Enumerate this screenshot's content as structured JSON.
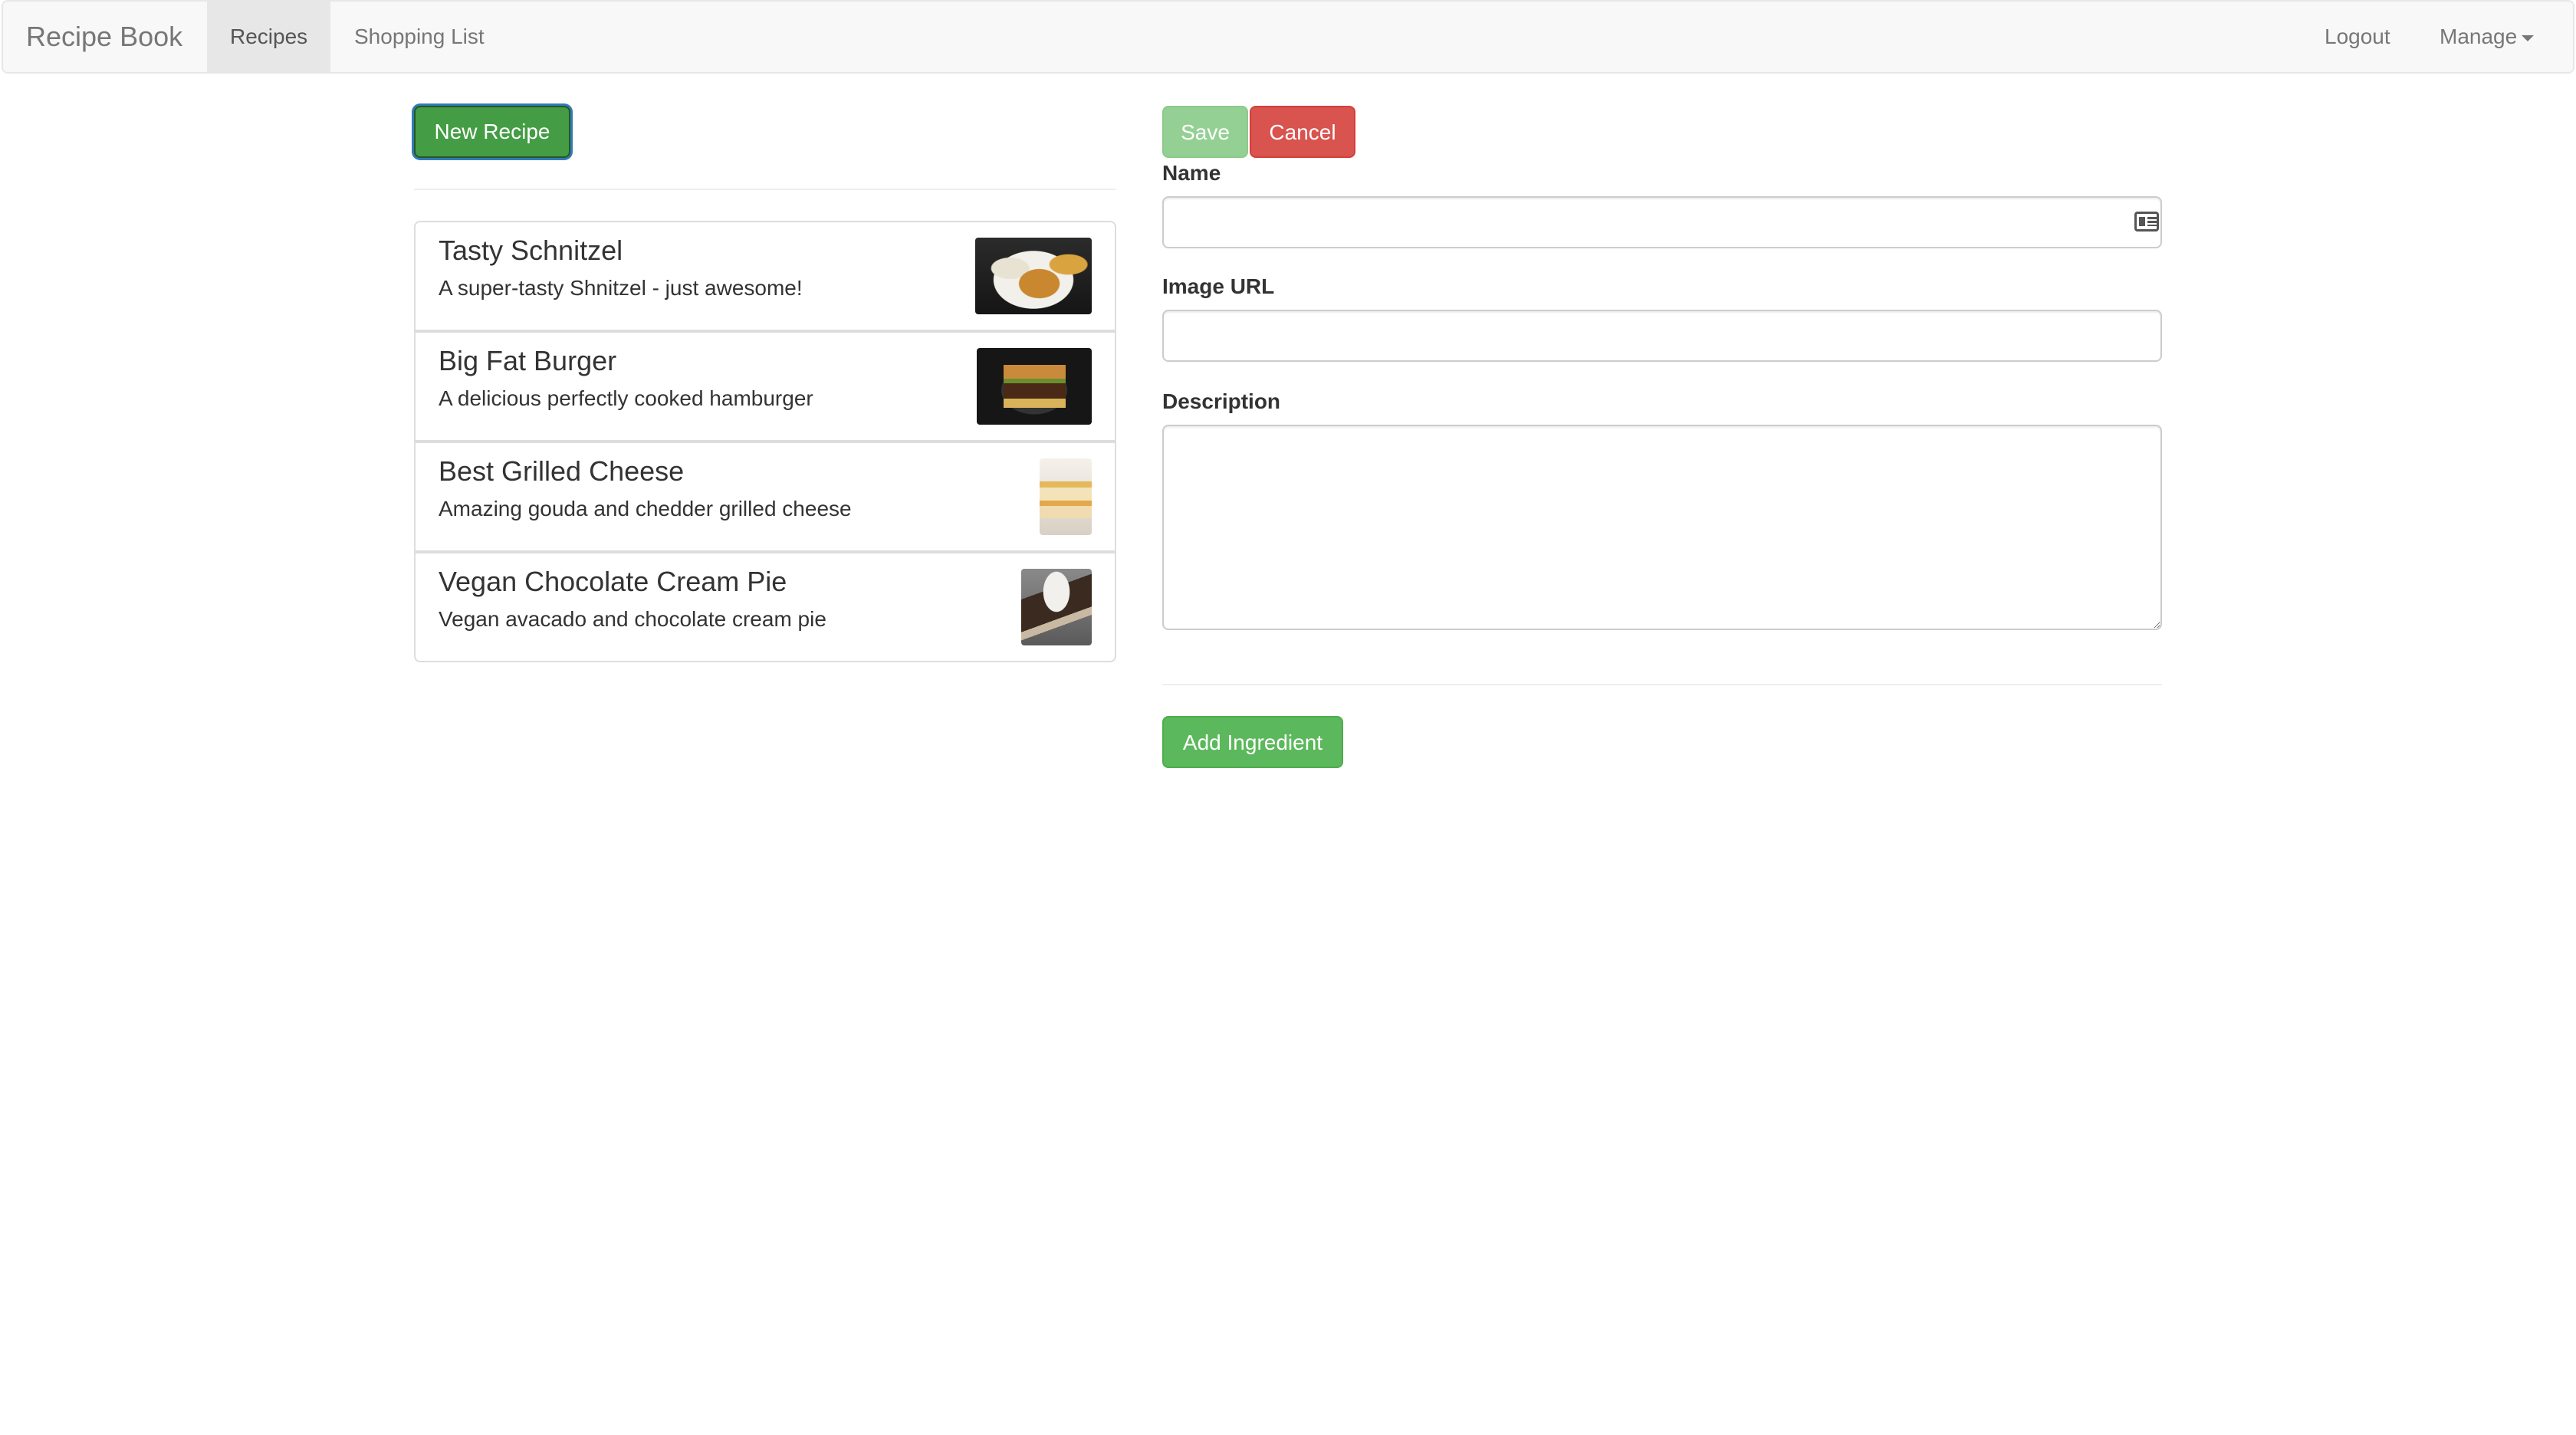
{
  "navbar": {
    "brand": "Recipe Book",
    "items": [
      {
        "label": "Recipes",
        "active": true
      },
      {
        "label": "Shopping List",
        "active": false
      }
    ],
    "logout_label": "Logout",
    "manage_label": "Manage"
  },
  "left": {
    "new_recipe_label": "New Recipe",
    "recipes": [
      {
        "name": "Tasty Schnitzel",
        "description": "A super-tasty Shnitzel - just awesome!"
      },
      {
        "name": "Big Fat Burger",
        "description": "A delicious perfectly cooked hamburger"
      },
      {
        "name": "Best Grilled Cheese",
        "description": "Amazing gouda and chedder grilled cheese"
      },
      {
        "name": "Vegan Chocolate Cream Pie",
        "description": "Vegan avacado and chocolate cream pie"
      }
    ]
  },
  "form": {
    "save_label": "Save",
    "cancel_label": "Cancel",
    "name_label": "Name",
    "name_value": "",
    "image_url_label": "Image URL",
    "image_url_value": "",
    "description_label": "Description",
    "description_value": "",
    "add_ingredient_label": "Add Ingredient"
  },
  "colors": {
    "success": "#5cb85c",
    "danger": "#d9534f",
    "focus_ring": "#337ab7"
  },
  "icons": {
    "autofill": "contact-card-icon",
    "dropdown": "caret-down-icon"
  }
}
